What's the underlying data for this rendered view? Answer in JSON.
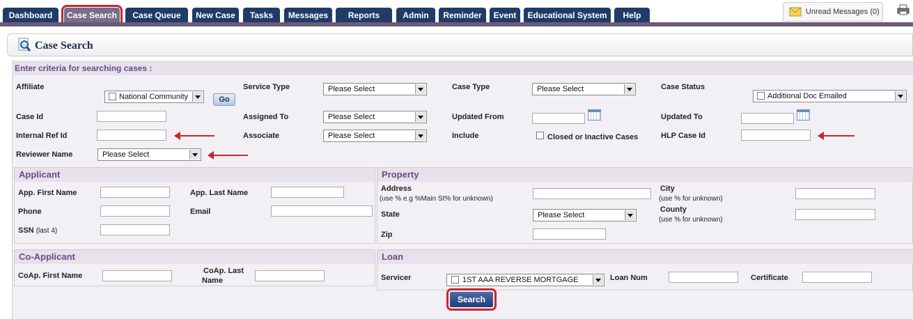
{
  "nav": {
    "tabs": [
      "Dashboard",
      "Case Search",
      "Case Queue",
      "New Case",
      "Tasks",
      "Messages",
      "Reports",
      "Admin",
      "Reminder",
      "Event",
      "Educational System",
      "Help"
    ],
    "active": "Case Search",
    "unread_label": "Unread Messages (0)"
  },
  "page": {
    "title": "Case Search",
    "criteria_header": "Enter criteria for searching cases :"
  },
  "criteria": {
    "affiliate_label": "Affiliate",
    "affiliate_value": "National Community",
    "go_label": "Go",
    "service_type_label": "Service Type",
    "service_type_value": "Please Select",
    "case_type_label": "Case Type",
    "case_type_value": "Please Select",
    "case_status_label": "Case Status",
    "case_status_value": "Additional Doc Emailed",
    "case_id_label": "Case Id",
    "assigned_to_label": "Assigned To",
    "assigned_to_value": "Please Select",
    "updated_from_label": "Updated From",
    "updated_to_label": "Updated To",
    "internal_ref_label": "Internal Ref Id",
    "associate_label": "Associate",
    "associate_value": "Please Select",
    "include_label": "Include",
    "include_checkbox_label": "Closed or Inactive Cases",
    "hlp_case_label": "HLP Case Id",
    "reviewer_label": "Reviewer Name",
    "reviewer_value": "Please Select"
  },
  "applicant": {
    "header": "Applicant",
    "first_name_label": "App. First Name",
    "last_name_label": "App. Last Name",
    "phone_label": "Phone",
    "email_label": "Email",
    "ssn_label": "SSN",
    "ssn_sub": "(last 4)"
  },
  "property": {
    "header": "Property",
    "address_label": "Address",
    "address_hint": "(use % e.g %Main St% for unknown)",
    "city_label": "City",
    "city_hint": "(use % for unknown)",
    "state_label": "State",
    "state_value": "Please Select",
    "county_label": "County",
    "county_hint": "(use % for unknown)",
    "zip_label": "Zip"
  },
  "coapplicant": {
    "header": "Co-Applicant",
    "first_name_label": "CoAp. First Name",
    "last_name_label_1": "CoAp. Last",
    "last_name_label_2": "Name"
  },
  "loan": {
    "header": "Loan",
    "servicer_label": "Servicer",
    "servicer_value": "1ST AAA REVERSE MORTGAGE",
    "loan_num_label": "Loan Num",
    "certificate_label": "Certificate"
  },
  "search_label": "Search"
}
